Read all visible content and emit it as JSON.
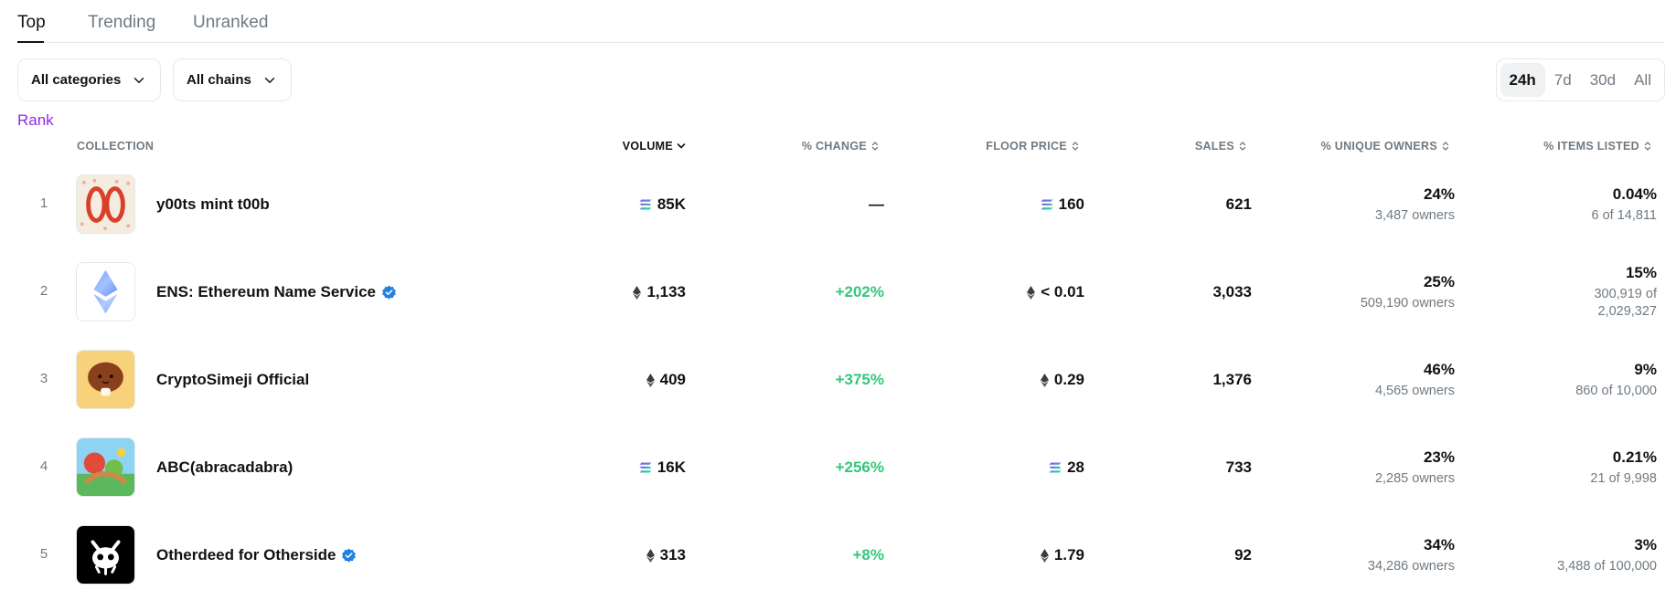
{
  "tabs": [
    {
      "label": "Top",
      "active": true
    },
    {
      "label": "Trending",
      "active": false
    },
    {
      "label": "Unranked",
      "active": false
    }
  ],
  "filters": {
    "categories": "All categories",
    "chains": "All chains"
  },
  "periods": [
    {
      "label": "24h",
      "active": true
    },
    {
      "label": "7d",
      "active": false
    },
    {
      "label": "30d",
      "active": false
    },
    {
      "label": "All",
      "active": false
    }
  ],
  "rank_label": "Rank",
  "columns": {
    "collection": "COLLECTION",
    "volume": "VOLUME",
    "change": "% CHANGE",
    "floor": "FLOOR PRICE",
    "sales": "SALES",
    "owners": "% UNIQUE OWNERS",
    "listed": "% ITEMS LISTED"
  },
  "rows": [
    {
      "rank": "1",
      "name": "y00ts mint t00b",
      "verified": false,
      "chain": "sol",
      "volume": "85K",
      "change": "—",
      "change_color": "neutral",
      "floor": "160",
      "sales": "621",
      "owners_pct": "24%",
      "owners_count": "3,487 owners",
      "listed_pct": "0.04%",
      "listed_detail": "6 of 14,811"
    },
    {
      "rank": "2",
      "name": "ENS: Ethereum Name Service",
      "verified": true,
      "chain": "eth",
      "volume": "1,133",
      "change": "+202%",
      "change_color": "green",
      "floor": "< 0.01",
      "sales": "3,033",
      "owners_pct": "25%",
      "owners_count": "509,190 owners",
      "listed_pct": "15%",
      "listed_detail": "300,919 of 2,029,327"
    },
    {
      "rank": "3",
      "name": "CryptoSimeji Official",
      "verified": false,
      "chain": "eth",
      "volume": "409",
      "change": "+375%",
      "change_color": "green",
      "floor": "0.29",
      "sales": "1,376",
      "owners_pct": "46%",
      "owners_count": "4,565 owners",
      "listed_pct": "9%",
      "listed_detail": "860 of 10,000"
    },
    {
      "rank": "4",
      "name": "ABC(abracadabra)",
      "verified": false,
      "chain": "sol",
      "volume": "16K",
      "change": "+256%",
      "change_color": "green",
      "floor": "28",
      "sales": "733",
      "owners_pct": "23%",
      "owners_count": "2,285 owners",
      "listed_pct": "0.21%",
      "listed_detail": "21 of 9,998"
    },
    {
      "rank": "5",
      "name": "Otherdeed for Otherside",
      "verified": true,
      "chain": "eth",
      "volume": "313",
      "change": "+8%",
      "change_color": "green",
      "floor": "1.79",
      "sales": "92",
      "owners_pct": "34%",
      "owners_count": "34,286 owners",
      "listed_pct": "3%",
      "listed_detail": "3,488 of 100,000"
    }
  ],
  "colors": {
    "accent": "#8a2be2",
    "positive": "#34c77b",
    "verified": "#2081e2",
    "muted": "#707a83"
  }
}
